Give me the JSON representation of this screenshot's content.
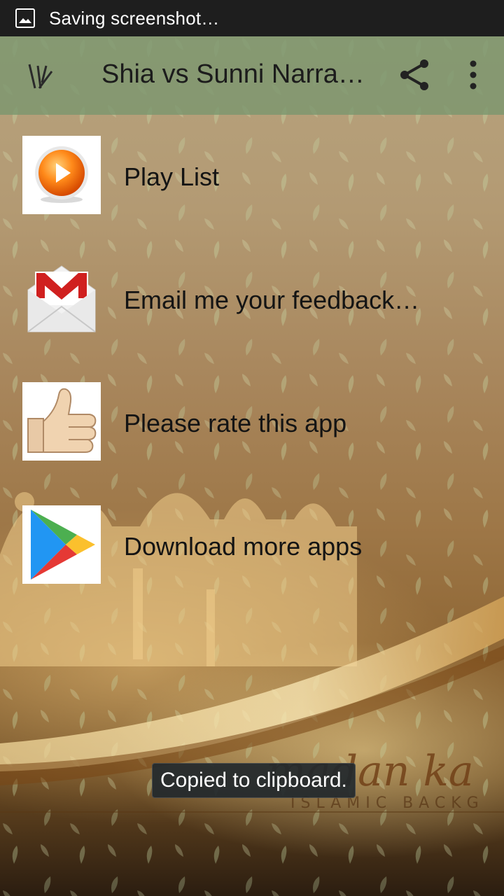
{
  "status_bar": {
    "notification_text": "Saving screenshot…",
    "icon": "image-icon"
  },
  "app_bar": {
    "title": "Shia vs Sunni Narra…",
    "logo_icon": "app-logo-icon",
    "share_icon": "share-icon",
    "more_icon": "more-vert-icon"
  },
  "menu": {
    "items": [
      {
        "label": "Play List",
        "icon": "play-button-icon"
      },
      {
        "label": "Email me your feedback…",
        "icon": "gmail-icon"
      },
      {
        "label": "Please rate this app",
        "icon": "thumbs-up-icon"
      },
      {
        "label": "Download more apps",
        "icon": "google-play-icon"
      }
    ]
  },
  "background": {
    "overlay_text": "madan ka",
    "overlay_subtext": "ISLAMIC BACKG"
  },
  "toast": {
    "text": "Copied to clipboard."
  },
  "colors": {
    "app_bar": "#789670",
    "status_bar": "#1e1e1e",
    "toast": "#22282c"
  }
}
